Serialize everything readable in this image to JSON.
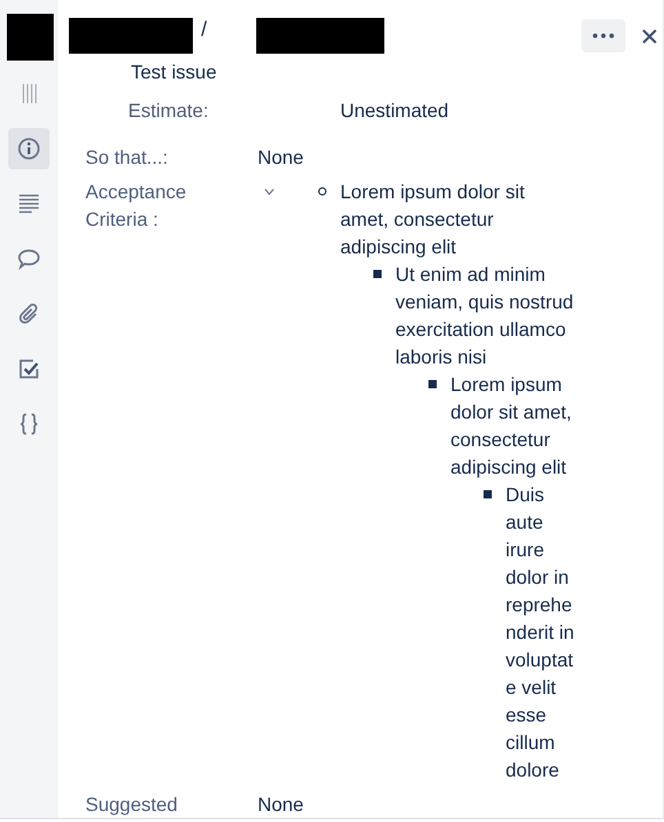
{
  "header": {
    "breadcrumb_separator": "/",
    "title": "Test issue"
  },
  "sidebar": {
    "items": [
      {
        "kind": "handle",
        "selected": false
      },
      {
        "kind": "info",
        "selected": true
      },
      {
        "kind": "description",
        "selected": false
      },
      {
        "kind": "comment",
        "selected": false
      },
      {
        "kind": "attachment",
        "selected": false
      },
      {
        "kind": "checklist",
        "selected": false
      },
      {
        "kind": "code",
        "selected": false
      }
    ]
  },
  "estimate": {
    "label": "Estimate:",
    "value": "Unestimated"
  },
  "fields": [
    {
      "kind": "text",
      "label": "So that...:",
      "value": "None"
    },
    {
      "kind": "list",
      "label": "Acceptance Criteria :",
      "expanded": true,
      "items": [
        {
          "text": "Lorem ipsum dolor sit amet, consectetur adipiscing elit",
          "children": [
            {
              "text": "Ut enim ad minim veniam, quis nostrud exercitation ullamco laboris nisi",
              "children": [
                {
                  "text": "Lorem ipsum dolor sit amet, consectetur adipiscing elit",
                  "children": [
                    {
                      "text": "Duis aute irure dolor in reprehenderit in voluptate velit esse cillum dolore"
                    }
                  ]
                }
              ]
            }
          ]
        }
      ]
    },
    {
      "kind": "text",
      "label": "Suggested",
      "value": "None"
    }
  ]
}
